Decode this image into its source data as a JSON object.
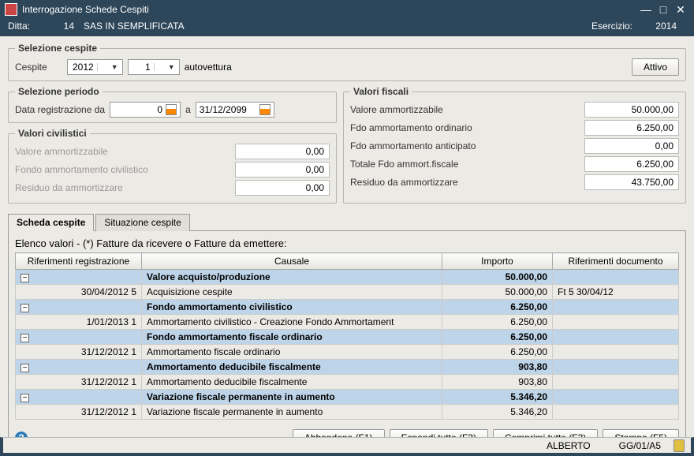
{
  "window": {
    "title": "Interrogazione Schede Cespiti"
  },
  "header": {
    "ditta_label": "Ditta:",
    "ditta_num": "14",
    "ditta_name": "SAS IN SEMPLIFICATA",
    "esercizio_label": "Esercizio:",
    "esercizio_val": "2014"
  },
  "selezione_cespite": {
    "legend": "Selezione cespite",
    "cespite_label": "Cespite",
    "year": "2012",
    "num": "1",
    "desc": "autovettura",
    "status": "Attivo"
  },
  "selezione_periodo": {
    "legend": "Selezione periodo",
    "label": "Data registrazione da",
    "from": "0",
    "a": "a",
    "to": "31/12/2099"
  },
  "civilistici": {
    "legend": "Valori civilistici",
    "rows": [
      {
        "label": "Valore ammortizzabile",
        "val": "0,00"
      },
      {
        "label": "Fondo ammortamento civilistico",
        "val": "0,00"
      },
      {
        "label": "Residuo da ammortizzare",
        "val": "0,00"
      }
    ]
  },
  "fiscali": {
    "legend": "Valori fiscali",
    "rows": [
      {
        "label": "Valore ammortizzabile",
        "val": "50.000,00"
      },
      {
        "label": "Fdo ammortamento ordinario",
        "val": "6.250,00"
      },
      {
        "label": "Fdo ammortamento anticipato",
        "val": "0,00"
      },
      {
        "label": "Totale Fdo ammort.fiscale",
        "val": "6.250,00"
      },
      {
        "label": "Residuo da ammortizzare",
        "val": "43.750,00"
      }
    ]
  },
  "tabs": {
    "t1": "Scheda cespite",
    "t2": "Situazione cespite"
  },
  "list": {
    "title": "Elenco valori - (*) Fatture da ricevere o Fatture da emettere:",
    "headers": {
      "c1": "Riferimenti registrazione",
      "c2": "Causale",
      "c3": "Importo",
      "c4": "Riferimenti documento"
    },
    "rows": [
      {
        "group": true,
        "c1": "",
        "c2": "Valore acquisto/produzione",
        "c3": "50.000,00",
        "c4": ""
      },
      {
        "group": false,
        "c1": "30/04/2012 5",
        "c2": "Acquisizione cespite",
        "c3": "50.000,00",
        "c4": "Ft 5 30/04/12"
      },
      {
        "group": true,
        "c1": "",
        "c2": "Fondo ammortamento civilistico",
        "c3": "6.250,00",
        "c4": ""
      },
      {
        "group": false,
        "c1": "1/01/2013 1",
        "c2": "Ammortamento civilistico - Creazione Fondo Ammortament",
        "c3": "6.250,00",
        "c4": ""
      },
      {
        "group": true,
        "c1": "",
        "c2": "Fondo ammortamento fiscale ordinario",
        "c3": "6.250,00",
        "c4": ""
      },
      {
        "group": false,
        "c1": "31/12/2012 1",
        "c2": "Ammortamento fiscale ordinario",
        "c3": "6.250,00",
        "c4": ""
      },
      {
        "group": true,
        "c1": "",
        "c2": "Ammortamento deducibile fiscalmente",
        "c3": "903,80",
        "c4": ""
      },
      {
        "group": false,
        "c1": "31/12/2012 1",
        "c2": "Ammortamento deducibile fiscalmente",
        "c3": "903,80",
        "c4": ""
      },
      {
        "group": true,
        "c1": "",
        "c2": "Variazione fiscale permanente in aumento",
        "c3": "5.346,20",
        "c4": ""
      },
      {
        "group": false,
        "c1": "31/12/2012 1",
        "c2": "Variazione fiscale permanente in aumento",
        "c3": "5.346,20",
        "c4": ""
      }
    ]
  },
  "footer": {
    "b1": "Abbandona (F1)",
    "b2": "Espandi tutto (F2)",
    "b3": "Comprimi tutto (F3)",
    "b4": "Stampa (F5)"
  },
  "status": {
    "user": "ALBERTO",
    "page": "GG/01/A5"
  }
}
